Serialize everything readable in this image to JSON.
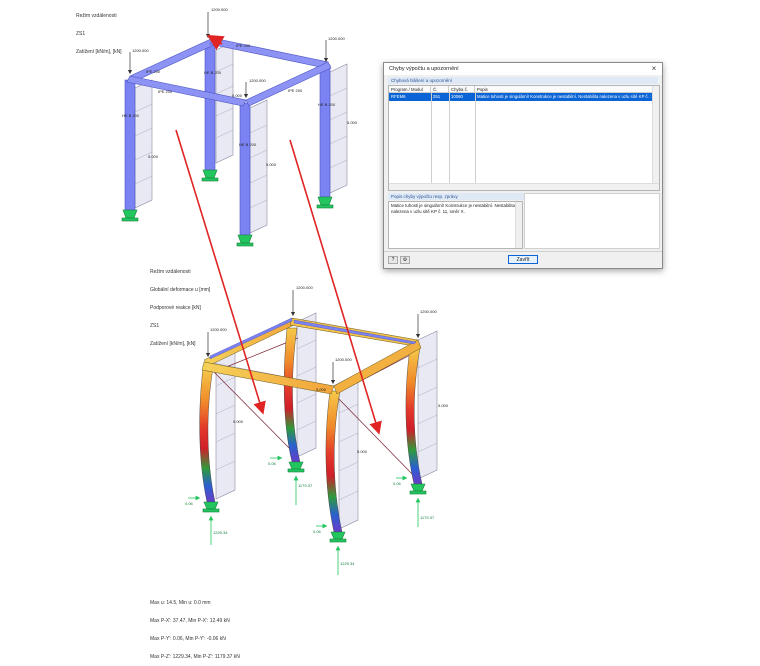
{
  "top_view": {
    "info": [
      "Režim vzdálenosti",
      "ZS1",
      "Zatížení [kN/m], [kN]"
    ],
    "loads": [
      "1200.000",
      "1200.000",
      "1200.000",
      "1200.000"
    ],
    "sections": [
      "IPE 200",
      "IPE 200",
      "IPE 200",
      "IPE 200",
      "HE B 200",
      "HE B 200",
      "HE B 200",
      "HE B 200"
    ],
    "panel_loads": [
      "5.000",
      "5.000",
      "5.000",
      "5.000"
    ]
  },
  "bottom_view": {
    "info": [
      "Režim vzdálenosti",
      "Globální deformace u [mm]",
      "Podporové reakce [kN]",
      "ZS1",
      "Zatížení [kN/m], [kN]"
    ],
    "loads": [
      "1200.000",
      "1200.000",
      "1200.000",
      "1200.000"
    ],
    "panel_loads": [
      "5.000",
      "5.000",
      "5.000",
      "5.000"
    ],
    "reactions": [
      "1179.37",
      "1229.34",
      "1179.37",
      "1229.34"
    ],
    "small_reactions": [
      "0.06",
      "0.06",
      "0.06",
      "0.06"
    ],
    "summary": [
      "Max u: 14.5, Min u: 0.0 mm",
      "Max P-X': 37.47, Min P-X': 12.49 kN",
      "Max P-Y': 0.06, Min P-Y': -0.06 kN",
      "Max P-Z': 1229.34, Min P-Z': 1179.37 kN"
    ]
  },
  "dialog": {
    "title": "Chyby výpočtu a upozornění",
    "close_icon": "×",
    "list_group": "Chybová hlášení a upozornění",
    "columns": [
      "Program / Modul",
      "Č.",
      "Chyba č.",
      "Popis"
    ],
    "row": {
      "program": "RFEM6",
      "number": "251",
      "error_no": "10060",
      "description": "Matice tuhosti je singulární! Konstrukce je nestabilní. Nestabilita nalezena v uzlu sítě KP č. 11, směr X."
    },
    "detail_group": "Popis chyby výpočtu resp. zprávy",
    "detail_text": "Matice tuhosti je singulární! Konstrukce je nestabilní. Nestabilita nalezena v uzlu sítě KP č. 11, směr X.",
    "close_button": "Zavřít"
  },
  "colors": {
    "beam": "#7b83f2",
    "support": "#22c55e",
    "arrow": "#e02424",
    "highlight": "#0a64d6"
  }
}
